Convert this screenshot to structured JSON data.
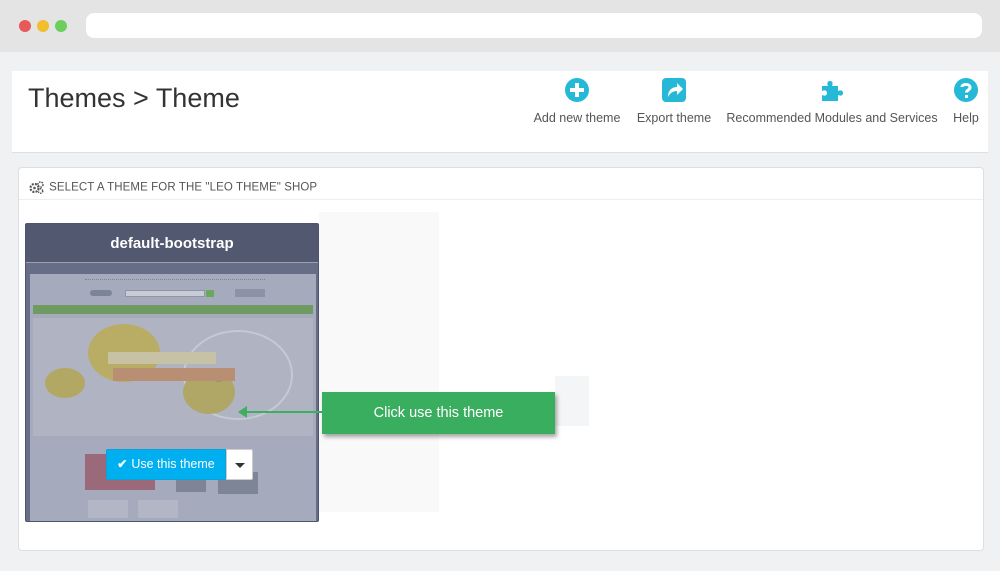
{
  "browser": {
    "url": ""
  },
  "header": {
    "breadcrumb_title": "Themes > Theme",
    "toolbar": [
      {
        "label": "Add new theme",
        "icon": "plus-circle-icon"
      },
      {
        "label": "Export theme",
        "icon": "share-icon"
      },
      {
        "label": "Recommended Modules and Services",
        "icon": "puzzle-icon"
      },
      {
        "label": "Help",
        "icon": "question-circle-icon"
      }
    ]
  },
  "panel": {
    "heading": "SELECT A THEME FOR THE \"LEO THEME\" SHOP",
    "heading_icon": "cogs-icon"
  },
  "theme_card": {
    "name": "default-bootstrap",
    "use_button": "Use this theme"
  },
  "annotation": {
    "callout_text": "Click use this theme"
  },
  "colors": {
    "accent_blue": "#00aff0",
    "annotation_green": "#3aae5f",
    "card_header": "#51586f",
    "toolbar_icon": "#25b9d7"
  }
}
